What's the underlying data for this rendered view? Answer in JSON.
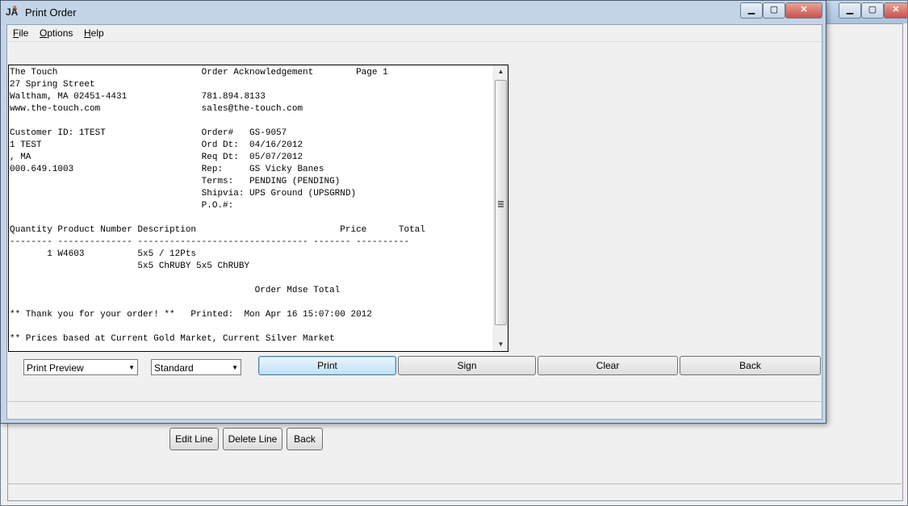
{
  "background_window": {
    "buttons": {
      "edit_line": "Edit Line",
      "delete_line": "Delete Line",
      "back": "Back"
    },
    "controls": {
      "minimize": "▁",
      "maximize": "▢",
      "close": "✕"
    }
  },
  "dialog": {
    "title": "Print Order",
    "app_icon": {
      "letters": "JA",
      "accent": "^"
    },
    "controls": {
      "minimize": "▁",
      "maximize": "▢",
      "close": "✕"
    },
    "menu": [
      {
        "accel": "F",
        "rest": "ile"
      },
      {
        "accel": "O",
        "rest": "ptions"
      },
      {
        "accel": "H",
        "rest": "elp"
      }
    ],
    "report_lines": [
      "The Touch                           Order Acknowledgement        Page 1",
      "27 Spring Street",
      "Waltham, MA 02451-4431              781.894.8133",
      "www.the-touch.com                   sales@the-touch.com",
      "",
      "Customer ID: 1TEST                  Order#   GS-9057",
      "1 TEST                              Ord Dt:  04/16/2012",
      ", MA                                Req Dt:  05/07/2012",
      "000.649.1003                        Rep:     GS Vicky Banes",
      "                                    Terms:   PENDING (PENDING)",
      "                                    Shipvia: UPS Ground (UPSGRND)",
      "                                    P.O.#:",
      "",
      "Quantity Product Number Description                           Price      Total",
      "-------- -------------- -------------------------------- ------- ----------",
      "       1 W4603          5x5 / 12Pts",
      "                        5x5 ChRUBY 5x5 ChRUBY",
      "",
      "                                              Order Mdse Total",
      "",
      "** Thank you for your order! **   Printed:  Mon Apr 16 15:07:00 2012",
      "",
      "** Prices based at Current Gold Market, Current Silver Market"
    ],
    "output_select": {
      "selected": "Print Preview"
    },
    "format_select": {
      "selected": "Standard"
    },
    "buttons": {
      "print": "Print",
      "sign": "Sign",
      "clear": "Clear",
      "back": "Back"
    }
  }
}
